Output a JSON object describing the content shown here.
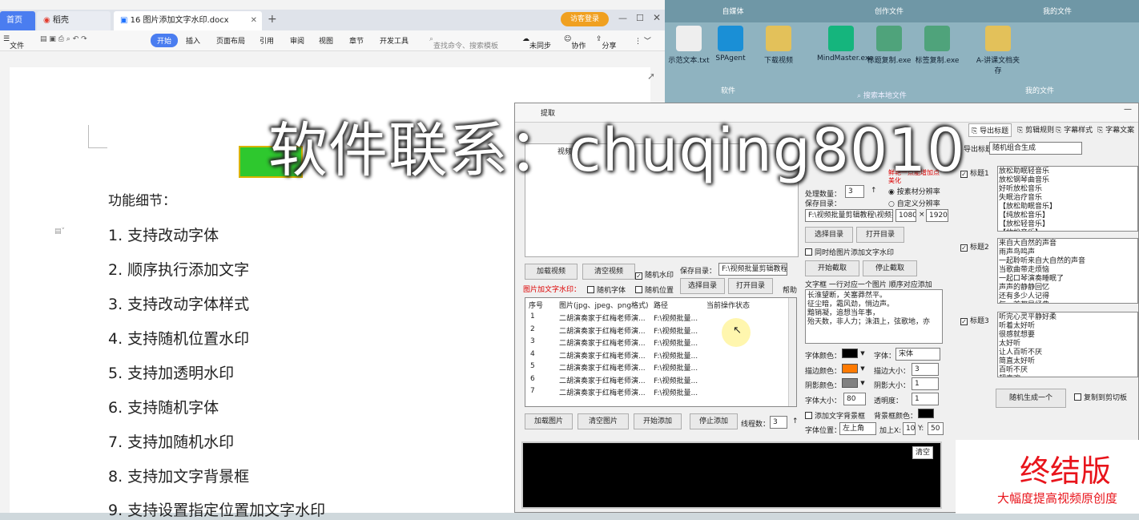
{
  "desktop": {
    "groups": [
      "自媒体",
      "创作文件",
      "我的文件",
      "软件",
      "我的文件"
    ],
    "icons": [
      "示范文本.txt",
      "SPAgent",
      "下载视频",
      "MindMaster.exe",
      "标题复制.exe",
      "标签复制.exe",
      "A-讲课文档夹存"
    ],
    "search": "搜索本地文件"
  },
  "wps": {
    "tabs": {
      "home": "首页",
      "app": "稻壳",
      "doc": "16 图片添加文字水印.docx"
    },
    "login": "访客登录",
    "menu": [
      "文件",
      "开始",
      "插入",
      "页面布局",
      "引用",
      "审阅",
      "视图",
      "章节",
      "开发工具"
    ],
    "search_placeholder": "查找命令、搜索模板",
    "sync": "未同步",
    "collab": "协作",
    "share": "分享",
    "heading": "功能细节：",
    "items": [
      "1. 支持改动字体",
      "2. 顺序执行添加文字",
      "3. 支持改动字体样式",
      "4. 支持随机位置水印",
      "5. 支持加透明水印",
      "6. 支持随机字体",
      "7. 支持加随机水印",
      "8. 支持加文字背景框",
      "9. 支持设置指定位置加文字水印"
    ]
  },
  "app": {
    "tabs_left": [
      "提取",
      "视频"
    ],
    "tabs_right": [
      "导出标题",
      "剪辑规则",
      "字幕样式",
      "字幕文案"
    ],
    "process_count_label": "处理数量：",
    "process_count": "3",
    "by_material": "按素材分辨率",
    "custom_res": "自定义分辨率",
    "save_dir_label": "保存目录：",
    "save_dir": "F:\\视频批量剪辑教程\\视频批",
    "width": "1080",
    "height": "1920",
    "choose_dir": "选择目录",
    "open_dir": "打开目录",
    "sync_watermark": "同时给图片添加文字水印",
    "start_cut": "开始截取",
    "stop_cut": "停止截取",
    "load_video": "加载视频",
    "clear_video": "清空视频",
    "random_watermark": "随机水印",
    "save_dir2_label": "保存目录：",
    "save_dir2": "F:\\视频批量剪辑教程",
    "img_wm_label": "图片加文字水印：",
    "random_font": "随机字体",
    "random_pos": "随机位置",
    "choose_dir2": "选择目录",
    "open_dir2": "打开目录",
    "help": "帮助",
    "grid_headers": [
      "序号",
      "图片(jpg、jpeg、png格式)",
      "路径",
      "当前操作状态"
    ],
    "grid_rows": [
      [
        "1",
        "二胡演奏家于红梅老师演...",
        "F:\\视频批量..."
      ],
      [
        "2",
        "二胡演奏家于红梅老师演...",
        "F:\\视频批量..."
      ],
      [
        "3",
        "二胡演奏家于红梅老师演...",
        "F:\\视频批量..."
      ],
      [
        "4",
        "二胡演奏家于红梅老师演...",
        "F:\\视频批量..."
      ],
      [
        "5",
        "二胡演奏家于红梅老师演...",
        "F:\\视频批量..."
      ],
      [
        "6",
        "二胡演奏家于红梅老师演...",
        "F:\\视频批量..."
      ],
      [
        "7",
        "二胡演奏家于红梅老师演...",
        "F:\\视频批量..."
      ]
    ],
    "load_img": "加载图片",
    "clear_img": "清空图片",
    "start_add": "开始添加",
    "stop_add": "停止添加",
    "threads_label": "线程数：",
    "threads": "3",
    "text_box_label": "文字框 一行对应一个图片 顺序对应添加",
    "text_lines": "长淮望断，关塞莽然平。\n征尘暗，霜风劲，悄边声。\n黯销凝，追想当年事，\n殆天数，非人力；洙泗上，弦歌地，亦",
    "font_color": "字体颜色：",
    "font_label": "字体：",
    "font_value": "宋体",
    "stroke_color": "描边颜色：",
    "stroke_size": "描边大小：",
    "stroke_val": "3",
    "shadow_color": "阴影颜色：",
    "shadow_size": "阴影大小：",
    "shadow_val": "1",
    "font_size": "字体大小：",
    "font_size_val": "80",
    "opacity": "透明度：",
    "opacity_val": "1",
    "bg_box": "添加文字背景框",
    "bg_color": "背景框颜色：",
    "font_pos": "字体位置：",
    "font_pos_val": "左上角",
    "addx": "加上X:",
    "x": "10",
    "y_label": "Y:",
    "y": "50",
    "clear": "清空",
    "export_title_label": "导出标题：",
    "export_mode": "随机组合生成",
    "title1": "标题1",
    "title1_text": "放松助眠轻音乐\n放松钢琴曲音乐\n好听放松音乐\n失眠治疗音乐\n【放松助眠音乐】\n【纯放松音乐】\n【放松轻音乐】\n【放松音乐】\n【纪录片音乐】",
    "title2": "标题2",
    "title2_text": "来自大自然的声音\n雨声鸟鸣声\n一起聆听来自大自然的声音\n当歌曲带走烦恼\n一起口琴演奏睡眠了\n声声的静静回忆\n还有多少人记得\n每一首都是经典\n适合静心享受音乐",
    "title3": "标题3",
    "title3_text": "听完心灵平静好柔\n听着太好听\n很感就想要\n太好听\n让人百听不厌\n简直太好听\n百听不厌\n超喜欢\n一边睡到天亮",
    "random_gen": "随机生成一个",
    "copy_clip": "复制到剪切板",
    "promo_title": "终结版",
    "promo_sub": "大幅度提高视频原创度",
    "top_right_label": "鲜艳一点能增加点美化"
  },
  "watermark": "软件联系：chuqing8010",
  "colors": {
    "accent": "#1e72ff",
    "wps_red": "#e23b2e",
    "promo_red": "#e8141b"
  }
}
